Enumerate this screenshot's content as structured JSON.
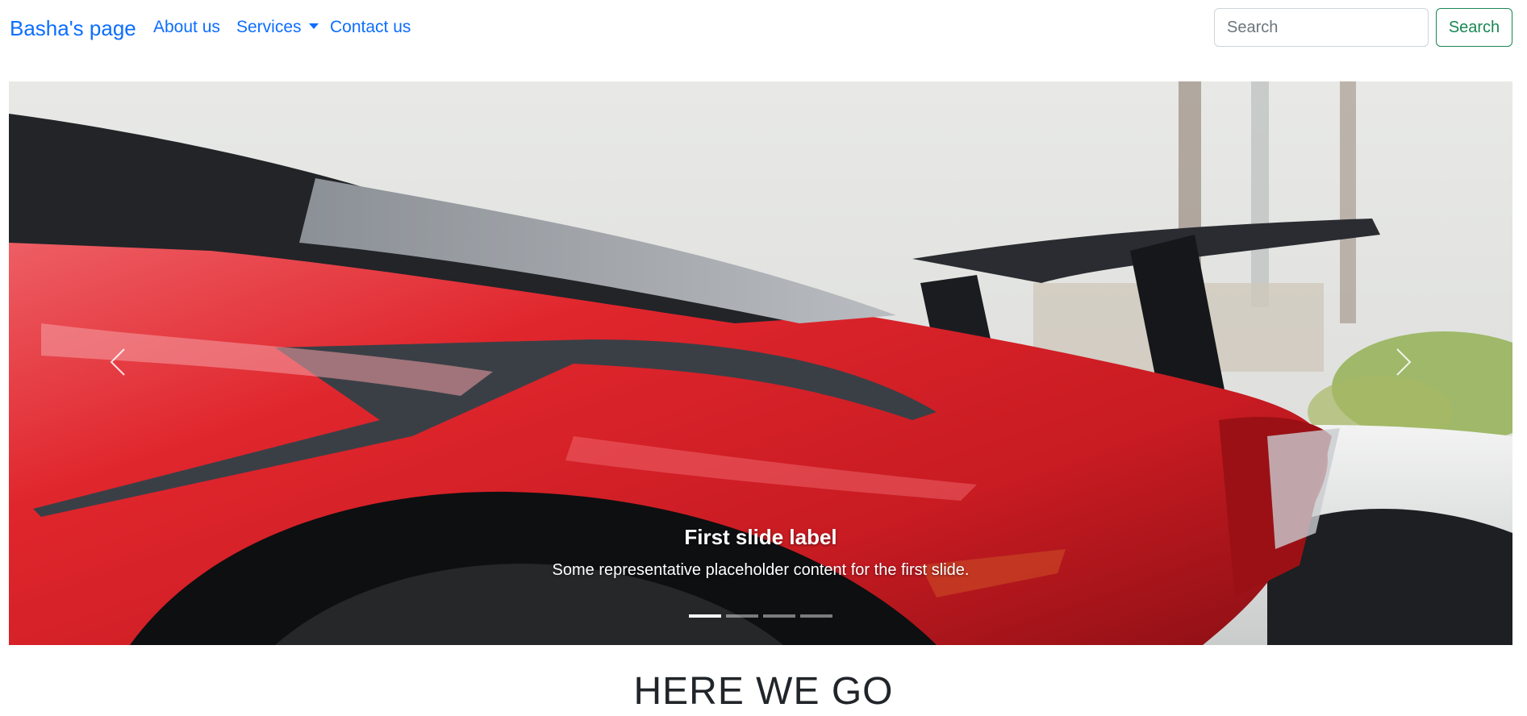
{
  "navbar": {
    "brand": "Basha's page",
    "links": [
      {
        "label": "About us"
      },
      {
        "label": "Services",
        "dropdown": true
      },
      {
        "label": "Contact us"
      }
    ],
    "search": {
      "placeholder": "Search",
      "value": "",
      "button_label": "Search"
    }
  },
  "carousel": {
    "active_slide": 1,
    "slide_count": 4,
    "caption": {
      "title": "First slide label",
      "text": "Some representative placeholder content for the first slide."
    },
    "icons": {
      "prev": "chevron-left-icon",
      "next": "chevron-right-icon"
    }
  },
  "main": {
    "heading": "HERE WE GO"
  },
  "colors": {
    "link": "#0d6efd",
    "success": "#198754",
    "car_red": "#d8232a"
  }
}
